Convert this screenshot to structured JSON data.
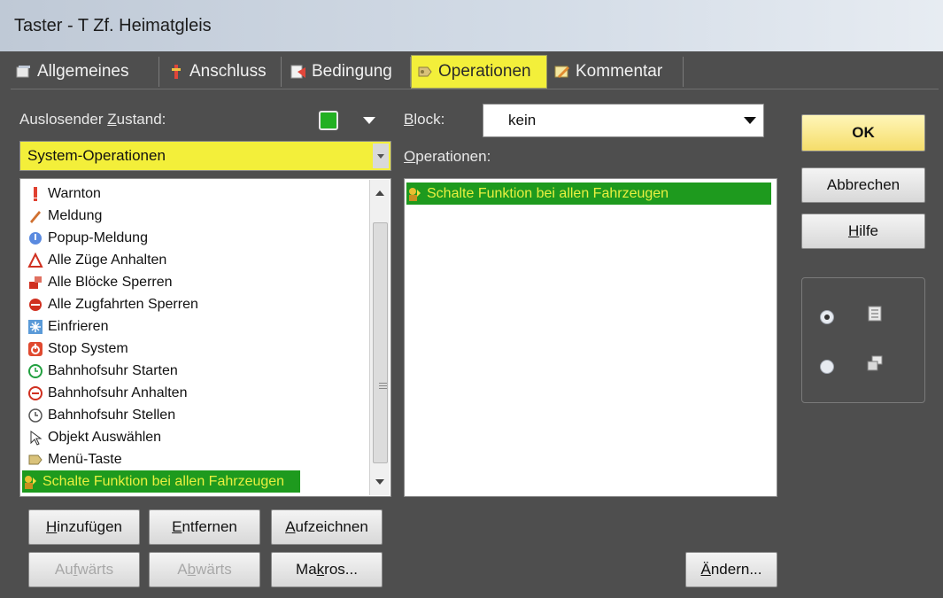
{
  "window": {
    "title": "Taster - T Zf. Heimatgleis"
  },
  "tabs": [
    {
      "label": "Allgemeines",
      "icon": "general-icon"
    },
    {
      "label": "Anschluss",
      "icon": "connection-icon"
    },
    {
      "label": "Bedingung",
      "icon": "condition-icon"
    },
    {
      "label": "Operationen",
      "icon": "operations-icon",
      "active": true
    },
    {
      "label": "Kommentar",
      "icon": "comment-icon"
    }
  ],
  "left": {
    "trigger_label_pre": "Auslosender ",
    "trigger_label_u": "Z",
    "trigger_label_post": "ustand:",
    "trigger_state_color": "#22b022",
    "category_value": "System-Operationen",
    "items": [
      {
        "label": "Warnton",
        "icon": "warning-icon"
      },
      {
        "label": "Meldung",
        "icon": "pencil-icon"
      },
      {
        "label": "Popup-Meldung",
        "icon": "popup-icon"
      },
      {
        "label": "Alle Züge Anhalten",
        "icon": "stop-trains-icon"
      },
      {
        "label": "Alle Blöcke Sperren",
        "icon": "lock-blocks-icon"
      },
      {
        "label": "Alle Zugfahrten Sperren",
        "icon": "lock-routes-icon"
      },
      {
        "label": "Einfrieren",
        "icon": "freeze-icon"
      },
      {
        "label": "Stop System",
        "icon": "power-icon"
      },
      {
        "label": "Bahnhofsuhr Starten",
        "icon": "clock-start-icon"
      },
      {
        "label": "Bahnhofsuhr Anhalten",
        "icon": "clock-stop-icon"
      },
      {
        "label": "Bahnhofsuhr Stellen",
        "icon": "clock-icon"
      },
      {
        "label": "Objekt Auswählen",
        "icon": "cursor-icon"
      },
      {
        "label": "Menü-Taste",
        "icon": "menu-key-icon"
      },
      {
        "label": "Schalte Funktion bei allen Fahrzeugen",
        "icon": "vehicle-function-icon",
        "selected": true
      }
    ]
  },
  "middle": {
    "block_label_u": "B",
    "block_label_post": "lock:",
    "block_value": "kein",
    "ops_label_u": "O",
    "ops_label_post": "perationen:",
    "operations": [
      {
        "label": "Schalte Funktion bei allen Fahrzeugen",
        "selected": true
      }
    ]
  },
  "buttons": {
    "add_u": "H",
    "add_post": "inzufügen",
    "remove_u": "E",
    "remove_post": "ntfernen",
    "record_u": "A",
    "record_post": "ufzeichnen",
    "up_pre": "Au",
    "up_u": "f",
    "up_post": "wärts",
    "down_pre": "A",
    "down_u": "b",
    "down_post": "wärts",
    "macros_pre": "Ma",
    "macros_u": "k",
    "macros_post": "ros...",
    "change_u": "Ä",
    "change_post": "ndern...",
    "ok": "OK",
    "cancel": "Abbrechen",
    "help_u": "H",
    "help_post": "ilfe"
  }
}
